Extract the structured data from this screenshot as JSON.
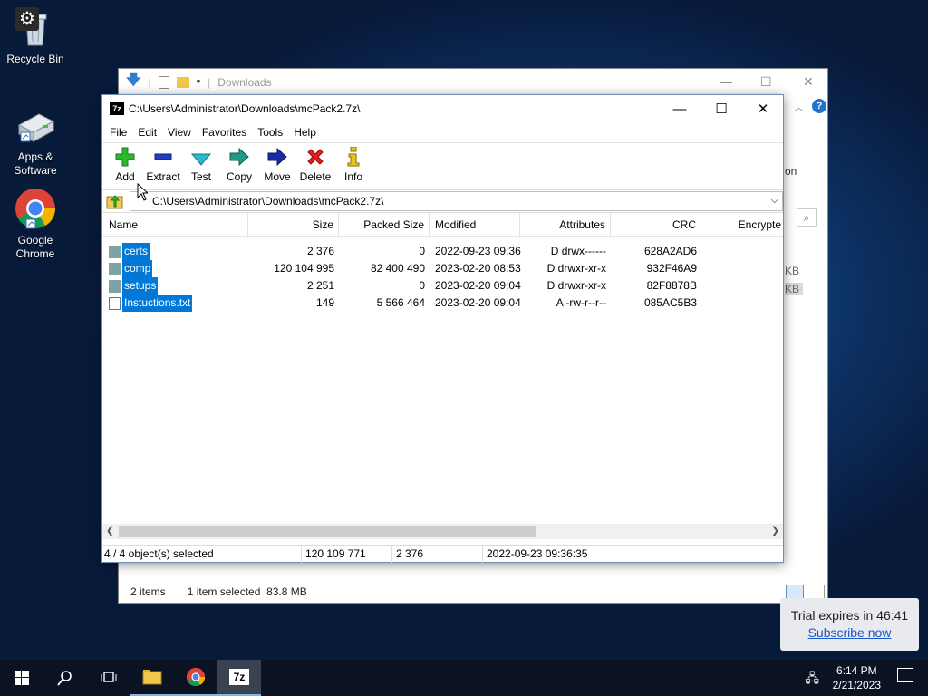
{
  "desktop": {
    "icons": [
      {
        "label": "Recycle Bin",
        "icon": "recycle-bin-icon"
      },
      {
        "label": "Apps &\nSoftware",
        "icon": "apps-software-icon"
      },
      {
        "label": "Google\nChrome",
        "icon": "chrome-icon"
      }
    ]
  },
  "explorer": {
    "title": "Downloads",
    "status_items": "2 items",
    "status_selected": "1 item selected  83.8 MB",
    "side_partial": [
      "on",
      "KB",
      "KB"
    ]
  },
  "sevenzip": {
    "title": "C:\\Users\\Administrator\\Downloads\\mcPack2.7z\\",
    "logo": "7z",
    "menu": [
      "File",
      "Edit",
      "View",
      "Favorites",
      "Tools",
      "Help"
    ],
    "toolbar": [
      {
        "label": "Add",
        "icon": "add-icon",
        "color": "#2db52d"
      },
      {
        "label": "Extract",
        "icon": "extract-icon",
        "color": "#1f3fbf"
      },
      {
        "label": "Test",
        "icon": "test-icon",
        "color": "#2bb8c9"
      },
      {
        "label": "Copy",
        "icon": "copy-icon",
        "color": "#1f9a8a"
      },
      {
        "label": "Move",
        "icon": "move-icon",
        "color": "#1a2aa0"
      },
      {
        "label": "Delete",
        "icon": "delete-icon",
        "color": "#e02020"
      },
      {
        "label": "Info",
        "icon": "info-icon",
        "color": "#e8c51c"
      }
    ],
    "address": "C:\\Users\\Administrator\\Downloads\\mcPack2.7z\\",
    "columns": [
      "Name",
      "Size",
      "Packed Size",
      "Modified",
      "Attributes",
      "CRC",
      "Encrypte"
    ],
    "rows": [
      {
        "name": "certs",
        "type": "folder",
        "size": "2 376",
        "packed": "0",
        "modified": "2022-09-23 09:36",
        "attr": "D drwx------",
        "crc": "628A2AD6"
      },
      {
        "name": "comp",
        "type": "folder",
        "size": "120 104 995",
        "packed": "82 400 490",
        "modified": "2023-02-20 08:53",
        "attr": "D drwxr-xr-x",
        "crc": "932F46A9"
      },
      {
        "name": "setups",
        "type": "folder",
        "size": "2 251",
        "packed": "0",
        "modified": "2023-02-20 09:04",
        "attr": "D drwxr-xr-x",
        "crc": "82F8878B"
      },
      {
        "name": "Instuctions.txt",
        "type": "file",
        "size": "149",
        "packed": "5 566 464",
        "modified": "2023-02-20 09:04",
        "attr": "A -rw-r--r--",
        "crc": "085AC5B3"
      }
    ],
    "status": {
      "selected": "4 / 4 object(s) selected",
      "size": "120 109 771",
      "packed": "2 376",
      "date": "2022-09-23 09:36:35"
    }
  },
  "taskbar": {
    "time": "6:14 PM",
    "date": "2/21/2023",
    "items": [
      "start-icon",
      "search-icon",
      "task-view-icon",
      "file-explorer-icon",
      "chrome-icon",
      "7zip-icon"
    ]
  },
  "toast": {
    "text": "Trial expires in 46:41",
    "link": "Subscribe now"
  },
  "colors": {
    "selection": "#0078d7",
    "accent": "#0078d7"
  }
}
